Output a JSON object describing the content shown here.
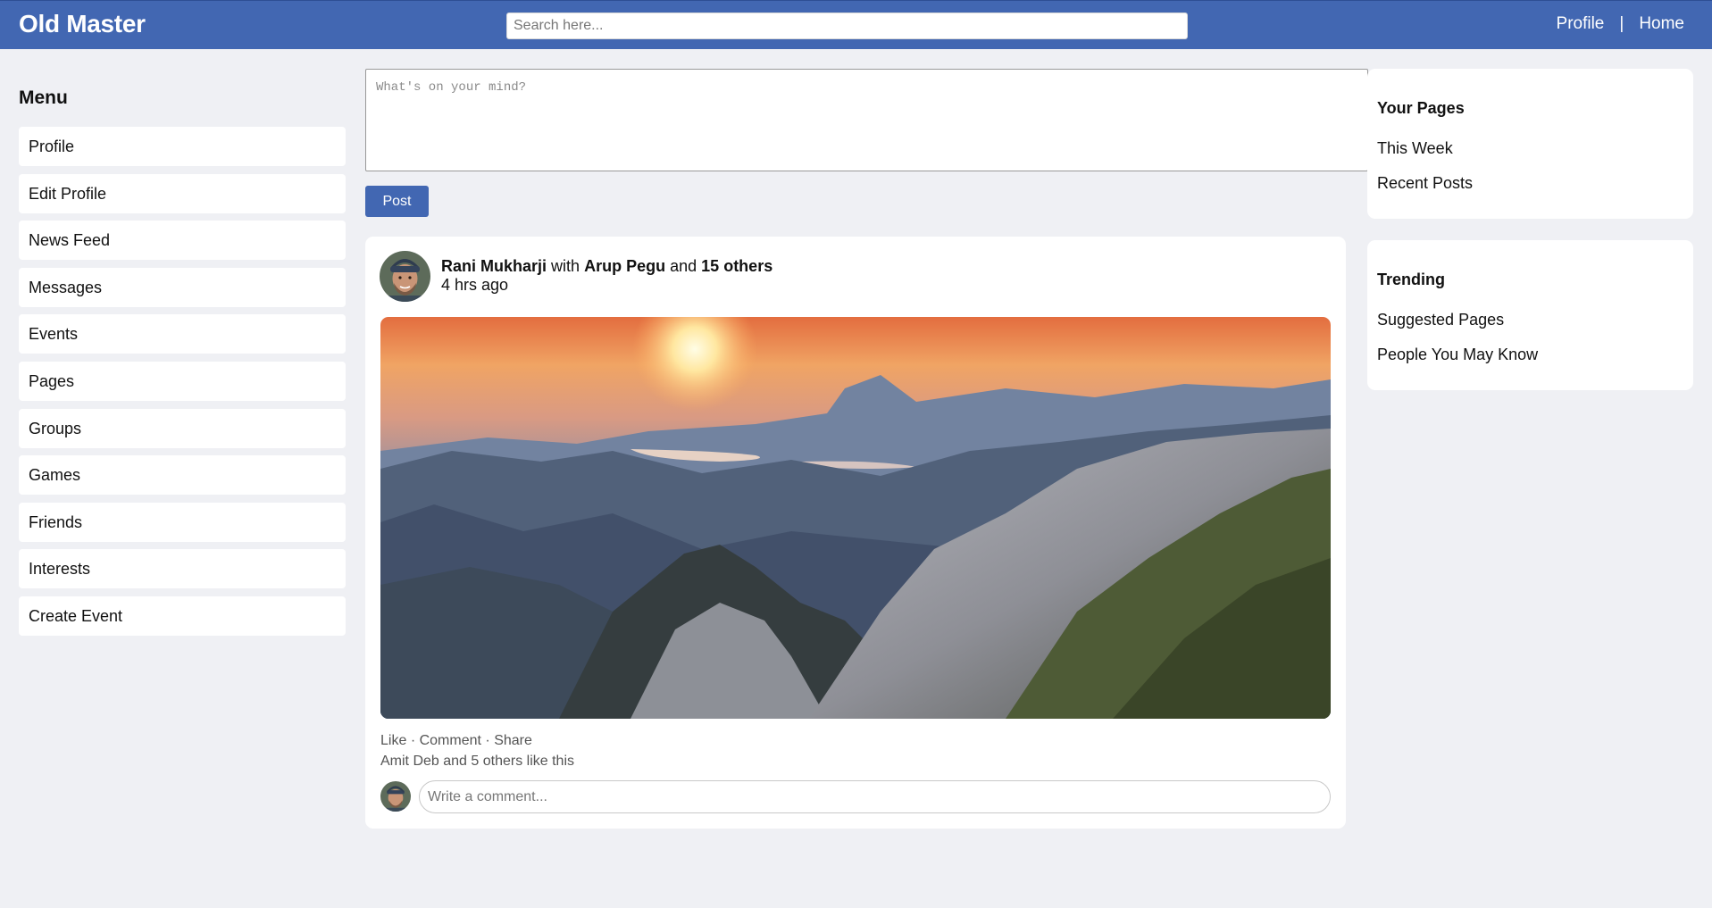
{
  "header": {
    "brand": "Old Master",
    "search_placeholder": "Search here...",
    "nav": {
      "profile": "Profile",
      "separator": "|",
      "home": "Home"
    }
  },
  "menu": {
    "title": "Menu",
    "items": [
      {
        "label": "Profile"
      },
      {
        "label": "Edit Profile"
      },
      {
        "label": "News Feed"
      },
      {
        "label": "Messages"
      },
      {
        "label": "Events"
      },
      {
        "label": "Pages"
      },
      {
        "label": "Groups"
      },
      {
        "label": "Games"
      },
      {
        "label": "Friends"
      },
      {
        "label": "Interests"
      },
      {
        "label": "Create Event"
      }
    ]
  },
  "composer": {
    "placeholder": "What's on your mind?",
    "post_label": "Post"
  },
  "post": {
    "author": "Rani Mukharji",
    "with_word": "with",
    "tagged": "Arup Pegu",
    "and_word": "and",
    "others": "15 others",
    "time": "4 hrs ago",
    "actions": {
      "like": "Like",
      "comment": "Comment",
      "share": "Share",
      "dot": "·"
    },
    "likes_text": "Amit Deb and 5 others like this",
    "comment_placeholder": "Write a comment..."
  },
  "sidebar_right": {
    "your_pages": {
      "title": "Your Pages",
      "links": [
        "This Week",
        "Recent Posts"
      ]
    },
    "trending": {
      "title": "Trending",
      "links": [
        "Suggested Pages",
        "People You May Know"
      ]
    }
  },
  "colors": {
    "brand_blue": "#4267b2",
    "page_bg": "#eff0f4"
  }
}
